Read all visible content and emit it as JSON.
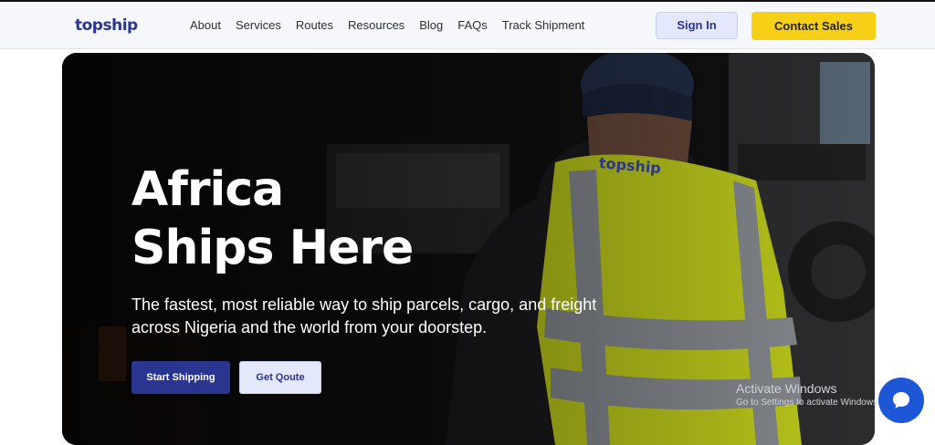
{
  "brand": {
    "logo_text": "topship"
  },
  "nav": {
    "items": [
      {
        "label": "About"
      },
      {
        "label": "Services"
      },
      {
        "label": "Routes"
      },
      {
        "label": "Resources"
      },
      {
        "label": "Blog"
      },
      {
        "label": "FAQs"
      },
      {
        "label": "Track Shipment"
      }
    ],
    "sign_in_label": "Sign In",
    "contact_label": "Contact Sales"
  },
  "hero": {
    "title_line1": "Africa",
    "title_line2": "Ships Here",
    "subtitle_line1": "The fastest, most reliable way to ship parcels, cargo, and freight",
    "subtitle_line2": "across Nigeria and the world from your doorstep.",
    "primary_cta": "Start Shipping",
    "secondary_cta": "Get Qoute",
    "vest_text": "topship"
  },
  "watermark": {
    "line1": "Activate Windows",
    "line2": "Go to Settings to activate Windows."
  },
  "colors": {
    "brand_blue": "#2a3590",
    "accent_yellow": "#f7cf17",
    "chat_blue": "#1e56d8",
    "vest_yellow": "#c7d51c"
  },
  "icons": {
    "chat": "chat-bubble-icon"
  }
}
